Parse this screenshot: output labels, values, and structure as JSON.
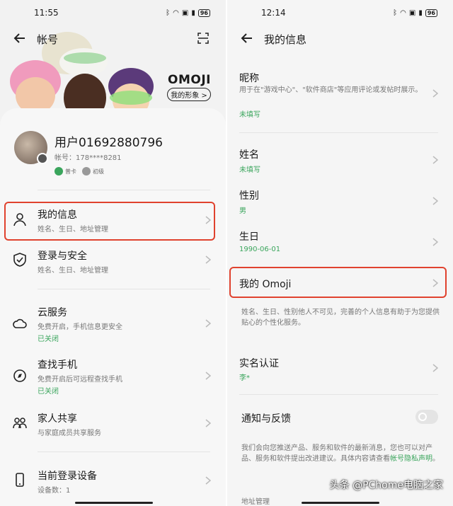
{
  "left": {
    "time": "11:55",
    "battery": "96",
    "title": "帐号",
    "omoji_logo": "OMOJI",
    "omoji_button": "我的形象 >",
    "user": {
      "name": "用户01692880796",
      "account": "帐号：178****8281",
      "badge1": "普卡",
      "badge2": "初级"
    },
    "items": [
      {
        "label": "我的信息",
        "sub": "姓名、生日、地址管理",
        "status": ""
      },
      {
        "label": "登录与安全",
        "sub": "姓名、生日、地址管理",
        "status": ""
      },
      {
        "label": "云服务",
        "sub": "免费开启，手机信息更安全",
        "status": "已关闭"
      },
      {
        "label": "查找手机",
        "sub": "免费开启后可远程查找手机",
        "status": "已关闭"
      },
      {
        "label": "家人共享",
        "sub": "与家庭成员共享服务",
        "status": ""
      },
      {
        "label": "当前登录设备",
        "sub": "设备数：1",
        "status": ""
      }
    ]
  },
  "right": {
    "time": "12:14",
    "battery": "96",
    "title": "我的信息",
    "nickname": {
      "label": "昵称",
      "desc": "用于在\"游戏中心\"、\"软件商店\"等应用评论或发帖时展示。",
      "value": "未填写"
    },
    "name": {
      "label": "姓名",
      "value": "未填写"
    },
    "gender": {
      "label": "性别",
      "value": "男"
    },
    "birthday": {
      "label": "生日",
      "value": "1990-06-01"
    },
    "omoji": {
      "label": "我的 Omoji"
    },
    "privacy_note": "姓名、生日、性别他人不可见，完善的个人信息有助于为您提供贴心的个性化服务。",
    "realname": {
      "label": "实名认证",
      "value": "李*"
    },
    "notify": {
      "label": "通知与反馈",
      "note_part1": "我们会向您推送产品、服务和软件的最新消息，您也可以对产品、服务和软件提出改进建议。具体内容请查看",
      "note_link": "帐号隐私声明",
      "note_end": "。"
    },
    "address": "地址管理"
  },
  "watermark": "头条 @PChome电脑之家",
  "colors": {
    "accent_green": "#3aa55c",
    "highlight_red": "#e0422e"
  }
}
